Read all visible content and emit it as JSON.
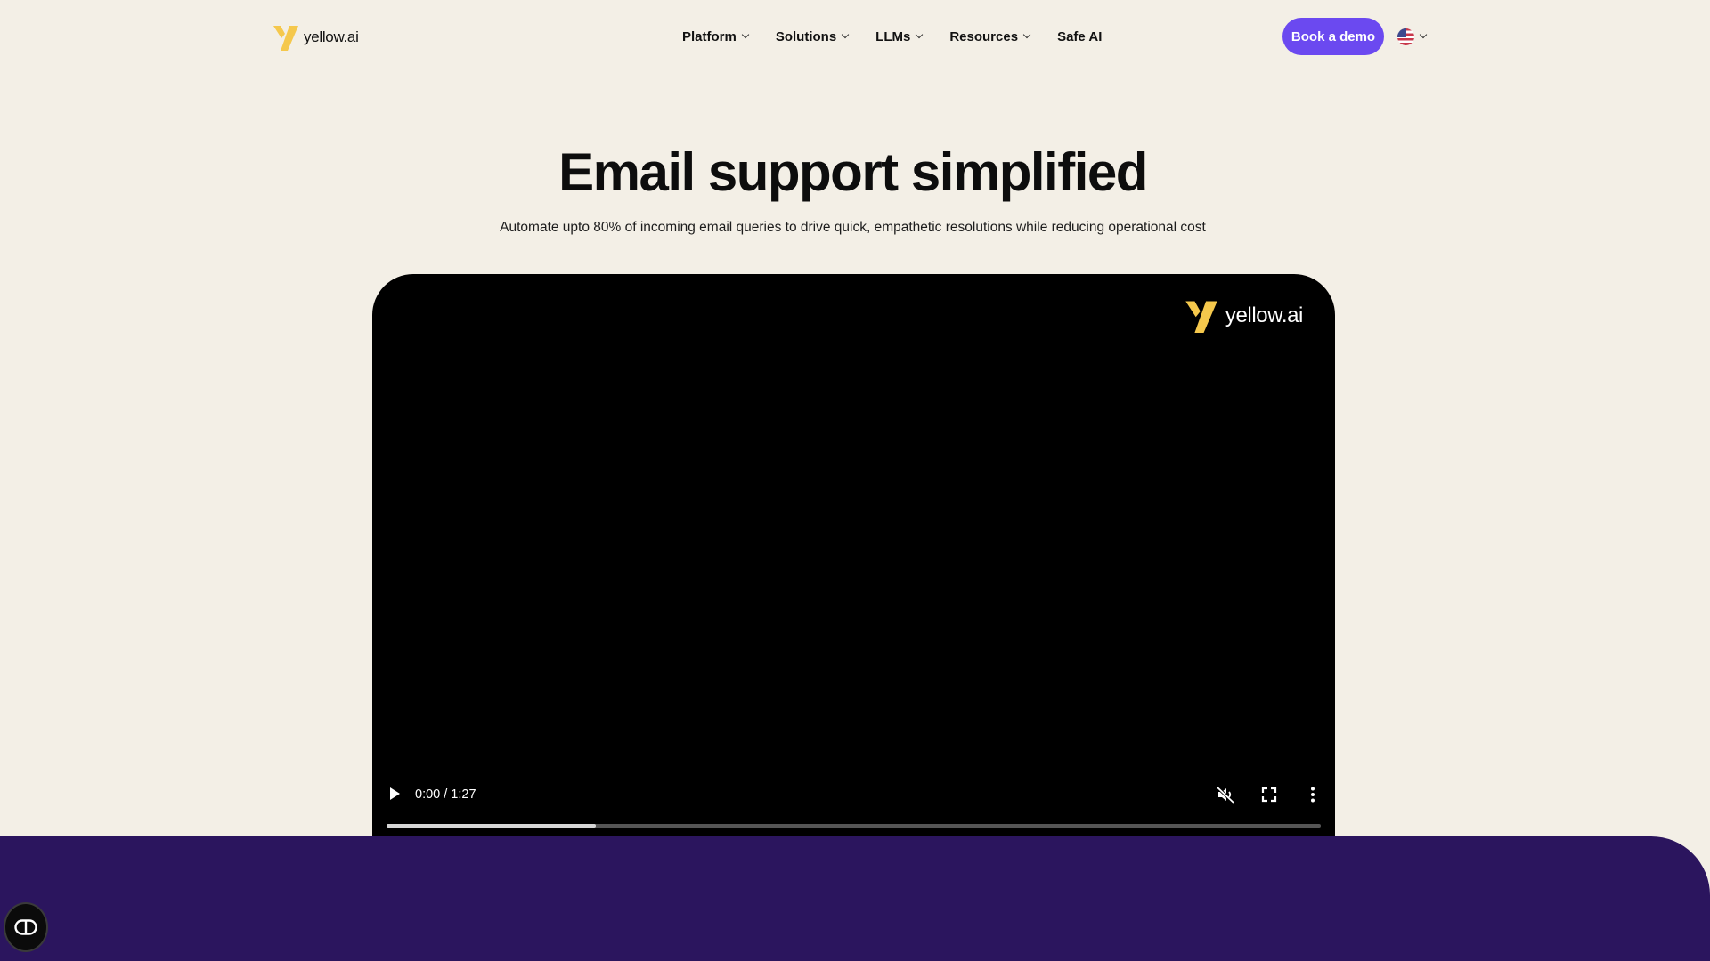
{
  "brand": {
    "name": "yellow.ai",
    "accent": "#f5c84c"
  },
  "nav": {
    "items": [
      {
        "label": "Platform",
        "has_dropdown": true
      },
      {
        "label": "Solutions",
        "has_dropdown": true
      },
      {
        "label": "LLMs",
        "has_dropdown": true
      },
      {
        "label": "Resources",
        "has_dropdown": true
      },
      {
        "label": "Safe AI",
        "has_dropdown": false
      }
    ],
    "cta_label": "Book a demo",
    "cta_color": "#6b49f0",
    "language_icon": "us-flag-icon"
  },
  "hero": {
    "title": "Email support simplified",
    "subtitle": "Automate upto 80% of incoming email queries to drive quick, empathetic resolutions while reducing operational cost"
  },
  "video": {
    "watermark": "yellow.ai",
    "time": "0:00 / 1:27",
    "progress_fraction": 0.224,
    "icons": [
      "play-icon",
      "muted-icon",
      "fullscreen-icon",
      "more-vertical-icon"
    ]
  },
  "footer_band_color": "#2b155e",
  "accessibility_icon": "accessibility-icon"
}
